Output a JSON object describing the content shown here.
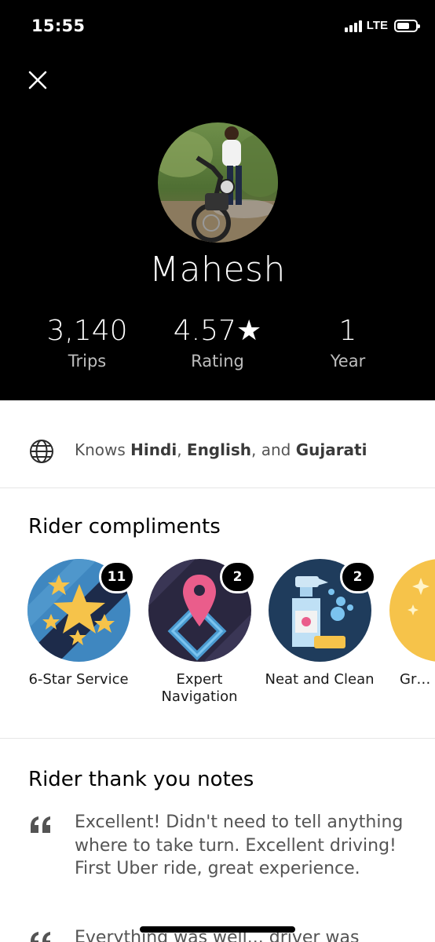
{
  "status_bar": {
    "time": "15:55",
    "network": "LTE"
  },
  "profile": {
    "name": "Mahesh",
    "stats": [
      {
        "value": "3,140",
        "label": "Trips"
      },
      {
        "value": "4.57★",
        "label": "Rating"
      },
      {
        "value": "1",
        "label": "Year"
      }
    ]
  },
  "languages": {
    "prefix": "Knows",
    "lang1": "Hindi",
    "sep1": ",",
    "lang2": "English",
    "sep2": ", and",
    "lang3": "Gujarati"
  },
  "compliments": {
    "title": "Rider compliments",
    "items": [
      {
        "label": "6-Star Service",
        "count": "11",
        "icon": "stars-icon"
      },
      {
        "label": "Expert Navigation",
        "count": "2",
        "icon": "map-pin-icon"
      },
      {
        "label": "Neat and Clean",
        "count": "2",
        "icon": "spray-bottle-icon"
      },
      {
        "label": "Gr… Ame…",
        "count": "",
        "icon": "sparkle-icon"
      }
    ]
  },
  "notes": {
    "title": "Rider thank you notes",
    "items": [
      {
        "text": "Excellent! Didn't need to tell anything where to take turn. Excellent driving! First Uber ride, great experience."
      },
      {
        "text": "Everything was well... driver was"
      }
    ]
  },
  "colors": {
    "header_bg": "#000000",
    "accent_blue": "#3f87c0",
    "navy": "#1d2b4a",
    "pin_pink": "#ea5d8b",
    "gold": "#f6c34a"
  }
}
